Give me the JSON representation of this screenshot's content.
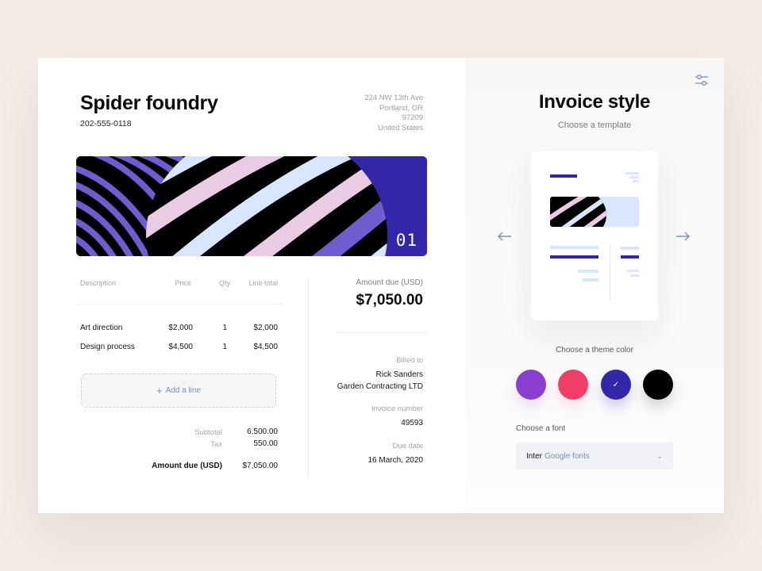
{
  "invoice": {
    "company": "Spider foundry",
    "phone": "202-555-0118",
    "address": [
      "224 NW 13th Ave",
      "Portland, OR",
      "97209",
      "United States"
    ],
    "banner_number": "01",
    "table": {
      "headers": [
        "Description",
        "Price",
        "Qty",
        "Line total"
      ],
      "rows": [
        {
          "description": "Art direction",
          "price": "$2,000",
          "qty": "1",
          "total": "$2,000"
        },
        {
          "description": "Design process",
          "price": "$4,500",
          "qty": "1",
          "total": "$4,500"
        }
      ],
      "add_line_label": "Add a line"
    },
    "summary": {
      "subtotal_label": "Subtotal",
      "subtotal_value": "6,500.00",
      "tax_label": "Tax",
      "tax_value": "550.00",
      "amount_due_label": "Amount due (USD)",
      "amount_due_value": "$7,050.00"
    },
    "amount_due": {
      "label": "Amount  due (USD)",
      "value": "$7,050.00"
    },
    "billed_to": {
      "label": "Billed to",
      "name": "Rick Sanders",
      "company": "Garden Contracting LTD"
    },
    "invoice_number": {
      "label": "Invoice number",
      "value": "49593"
    },
    "due_date": {
      "label": "Due date",
      "value": "16 March, 2020"
    }
  },
  "style_panel": {
    "title": "Invoice style",
    "subtitle": "Choose a template",
    "theme_label": "Choose a theme color",
    "theme_colors": [
      "#8a3ed0",
      "#f23d68",
      "#3326a8",
      "#000000"
    ],
    "selected_color": "#3326a8",
    "font_label": "Choose a font",
    "font_name": "Inter",
    "font_source": "Google fonts",
    "icons": [
      "settings-sliders-icon",
      "arrow-left-icon",
      "arrow-right-icon",
      "check-icon",
      "chevron-down-icon",
      "plus-icon"
    ]
  }
}
